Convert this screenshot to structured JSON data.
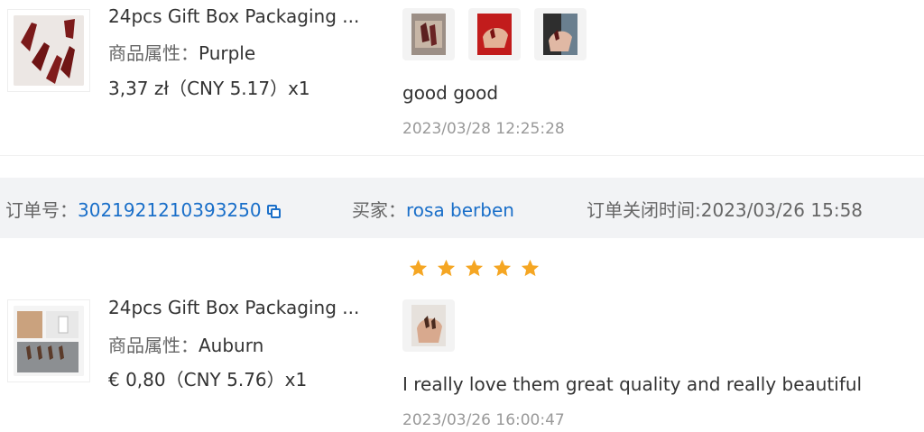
{
  "orders": [
    {
      "product_title": "24pcs Gift Box Packaging ...",
      "attr_key": "商品属性：",
      "attr_value": "Purple",
      "price": "3,37 zł（CNY  5.17）x1",
      "review_text": "good good",
      "review_time": "2023/03/28 12:25:28",
      "photo_count": 3
    },
    {
      "product_title": "24pcs Gift Box Packaging ...",
      "attr_key": "商品属性：",
      "attr_value": "Auburn",
      "price": "€ 0,80（CNY  5.76）x1",
      "review_text": "I really love them great quality and really beautiful",
      "review_time": "2023/03/26 16:00:47",
      "rating": 5,
      "photo_count": 1
    }
  ],
  "order_bar": {
    "order_no_label": "订单号：",
    "order_no": "3021921210393250",
    "buyer_label": "买家：",
    "buyer": "rosa berben",
    "closed_label": "订单关闭时间:",
    "closed_time": "2023/03/26 15:58"
  },
  "colors": {
    "link": "#1a6fc9",
    "star": "#f5a623",
    "bar_bg": "#f2f3f5"
  },
  "icons": {
    "copy": "copy-icon",
    "star": "star-icon"
  }
}
